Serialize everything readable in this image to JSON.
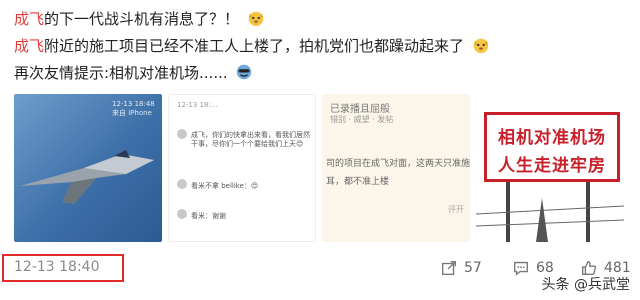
{
  "post": {
    "line1": {
      "kw": "成飞",
      "rest": "的下一代战斗机有消息了？！"
    },
    "line2": {
      "kw": "成飞",
      "rest": "附近的施工项目已经不准工人上楼了，拍机党们也都躁动起来了"
    },
    "line3": "再次友情提示:相机对准机场......",
    "emoji_icons": [
      "dog-emoji-icon",
      "dog-emoji-icon",
      "cool-emoji-icon"
    ]
  },
  "thumbnails": {
    "t1": {
      "timestamp": "12-13 18:48",
      "sub": "来自 iPhone"
    },
    "t2": {
      "timestamp": "12-13 18:...",
      "comments": [
        "成飞，你们的快拿出来看，看我们居然干事，尽你们一个个要给我们上天😊",
        "看米不拿 bellike：😊",
        "看米：谢谢"
      ]
    },
    "t3": {
      "header": "已录播且屈般",
      "sub": "错别 · 威望 · 发帖",
      "line1": "司的项目在成飞对面，这两天只准施",
      "line2": "耳，都不准上楼",
      "tag": "评开"
    },
    "t4": {
      "sign_line1": "相机对准机场",
      "sign_line2": "人生走进牢房"
    }
  },
  "footer": {
    "timestamp": "12-13 18:40",
    "share_count": "57",
    "comment_count": "68",
    "like_count": "481"
  },
  "watermark": "头条 @兵武堂",
  "colors": {
    "keyword": "#e33b3b",
    "highlight_box": "#e32a2a",
    "sign_red": "#c8202a"
  }
}
